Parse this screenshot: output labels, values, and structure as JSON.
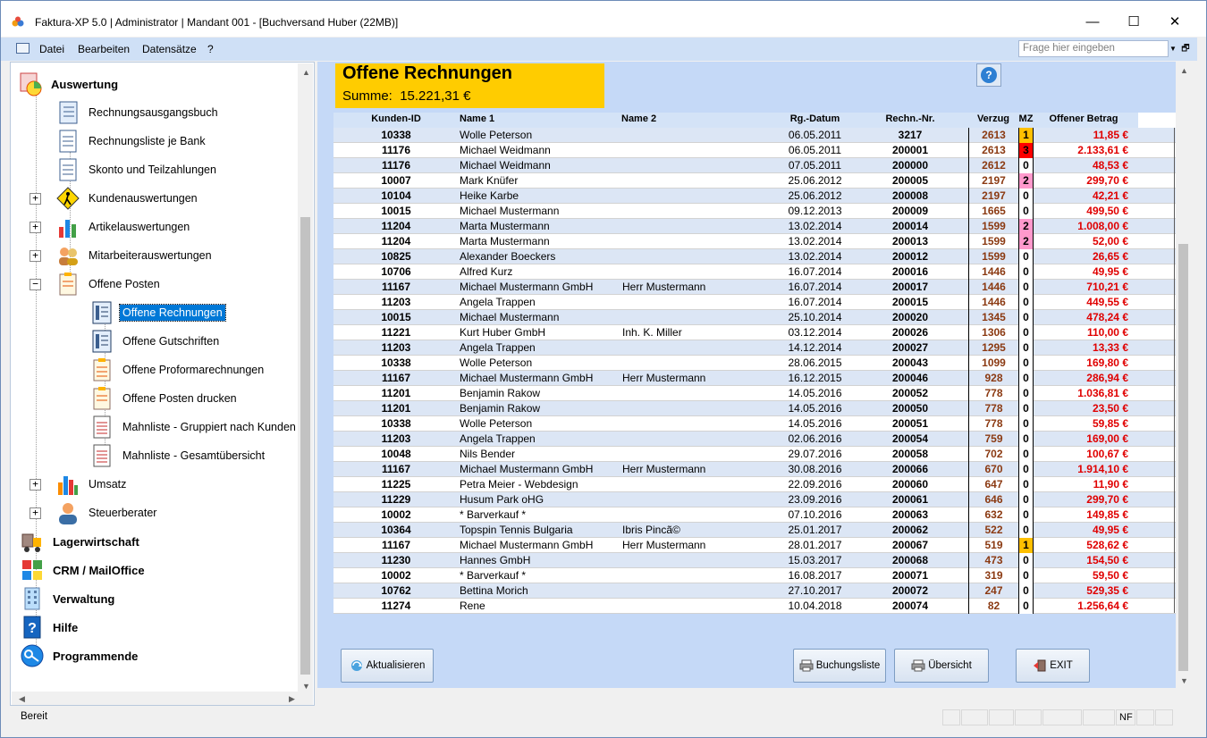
{
  "window": {
    "title": "Faktura-XP 5.0 | Administrator | Mandant 001 - [Buchversand Huber (22MB)]",
    "minimize_glyph": "—",
    "maximize_glyph": "☐",
    "close_glyph": "✕"
  },
  "menu": {
    "items": [
      "Datei",
      "Bearbeiten",
      "Datensätze",
      "?"
    ],
    "help_placeholder": "Frage hier eingeben",
    "drop_glyph": "▼",
    "restore_glyph": "🗗"
  },
  "tree": {
    "auswertung": "Auswertung",
    "items": [
      "Rechnungsausgangsbuch",
      "Rechnungsliste je Bank",
      "Skonto und Teilzahlungen",
      "Kundenauswertungen",
      "Artikelauswertungen",
      "Mitarbeiterauswertungen",
      "Offene Posten",
      "Offene Rechnungen",
      "Offene Gutschriften",
      "Offene Proformarechnungen",
      "Offene Posten drucken",
      "Mahnliste - Gruppiert nach Kunden",
      "Mahnliste - Gesamtübersicht",
      "Umsatz",
      "Steuerberater"
    ],
    "modules": [
      "Lagerwirtschaft",
      "CRM / MailOffice",
      "Verwaltung",
      "Hilfe",
      "Programmende"
    ],
    "expand_glyph": "+",
    "collapse_glyph": "−"
  },
  "header": {
    "title": "Offene Rechnungen",
    "summe_label": "Summe:",
    "summe_value": "15.221,31 €",
    "help_glyph": "?"
  },
  "grid": {
    "columns": [
      "Kunden-ID",
      "Name 1",
      "Name 2",
      "Rg.-Datum",
      "Rechn.-Nr.",
      "Verzug",
      "MZ",
      "Offener Betrag"
    ],
    "rows": [
      {
        "id": "10338",
        "name1": "Wolle Peterson",
        "name2": "",
        "date": "06.05.2011",
        "nr": "3217",
        "verzug": "2613",
        "mz": "1",
        "betrag": "11,85 €"
      },
      {
        "id": "11176",
        "name1": "Michael Weidmann",
        "name2": "",
        "date": "06.05.2011",
        "nr": "200001",
        "verzug": "2613",
        "mz": "3",
        "betrag": "2.133,61 €"
      },
      {
        "id": "11176",
        "name1": "Michael Weidmann",
        "name2": "",
        "date": "07.05.2011",
        "nr": "200000",
        "verzug": "2612",
        "mz": "0",
        "betrag": "48,53 €"
      },
      {
        "id": "10007",
        "name1": "Mark Knüfer",
        "name2": "",
        "date": "25.06.2012",
        "nr": "200005",
        "verzug": "2197",
        "mz": "2",
        "betrag": "299,70 €"
      },
      {
        "id": "10104",
        "name1": "Heike Karbe",
        "name2": "",
        "date": "25.06.2012",
        "nr": "200008",
        "verzug": "2197",
        "mz": "0",
        "betrag": "42,21 €"
      },
      {
        "id": "10015",
        "name1": "Michael Mustermann",
        "name2": "",
        "date": "09.12.2013",
        "nr": "200009",
        "verzug": "1665",
        "mz": "0",
        "betrag": "499,50 €"
      },
      {
        "id": "11204",
        "name1": "Marta Mustermann",
        "name2": "",
        "date": "13.02.2014",
        "nr": "200014",
        "verzug": "1599",
        "mz": "2",
        "betrag": "1.008,00 €"
      },
      {
        "id": "11204",
        "name1": "Marta Mustermann",
        "name2": "",
        "date": "13.02.2014",
        "nr": "200013",
        "verzug": "1599",
        "mz": "2",
        "betrag": "52,00 €"
      },
      {
        "id": "10825",
        "name1": "Alexander Boeckers",
        "name2": "",
        "date": "13.02.2014",
        "nr": "200012",
        "verzug": "1599",
        "mz": "0",
        "betrag": "26,65 €"
      },
      {
        "id": "10706",
        "name1": "Alfred Kurz",
        "name2": "",
        "date": "16.07.2014",
        "nr": "200016",
        "verzug": "1446",
        "mz": "0",
        "betrag": "49,95 €"
      },
      {
        "id": "11167",
        "name1": "Michael Mustermann GmbH",
        "name2": "Herr Mustermann",
        "date": "16.07.2014",
        "nr": "200017",
        "verzug": "1446",
        "mz": "0",
        "betrag": "710,21 €"
      },
      {
        "id": "11203",
        "name1": "Angela Trappen",
        "name2": "",
        "date": "16.07.2014",
        "nr": "200015",
        "verzug": "1446",
        "mz": "0",
        "betrag": "449,55 €"
      },
      {
        "id": "10015",
        "name1": "Michael Mustermann",
        "name2": "",
        "date": "25.10.2014",
        "nr": "200020",
        "verzug": "1345",
        "mz": "0",
        "betrag": "478,24 €"
      },
      {
        "id": "11221",
        "name1": "Kurt Huber GmbH",
        "name2": "Inh. K. Miller",
        "date": "03.12.2014",
        "nr": "200026",
        "verzug": "1306",
        "mz": "0",
        "betrag": "110,00 €"
      },
      {
        "id": "11203",
        "name1": "Angela Trappen",
        "name2": "",
        "date": "14.12.2014",
        "nr": "200027",
        "verzug": "1295",
        "mz": "0",
        "betrag": "13,33 €"
      },
      {
        "id": "10338",
        "name1": "Wolle Peterson",
        "name2": "",
        "date": "28.06.2015",
        "nr": "200043",
        "verzug": "1099",
        "mz": "0",
        "betrag": "169,80 €"
      },
      {
        "id": "11167",
        "name1": "Michael Mustermann GmbH",
        "name2": "Herr Mustermann",
        "date": "16.12.2015",
        "nr": "200046",
        "verzug": "928",
        "mz": "0",
        "betrag": "286,94 €"
      },
      {
        "id": "11201",
        "name1": "Benjamin Rakow",
        "name2": "",
        "date": "14.05.2016",
        "nr": "200052",
        "verzug": "778",
        "mz": "0",
        "betrag": "1.036,81 €"
      },
      {
        "id": "11201",
        "name1": "Benjamin Rakow",
        "name2": "",
        "date": "14.05.2016",
        "nr": "200050",
        "verzug": "778",
        "mz": "0",
        "betrag": "23,50 €"
      },
      {
        "id": "10338",
        "name1": "Wolle Peterson",
        "name2": "",
        "date": "14.05.2016",
        "nr": "200051",
        "verzug": "778",
        "mz": "0",
        "betrag": "59,85 €"
      },
      {
        "id": "11203",
        "name1": "Angela Trappen",
        "name2": "",
        "date": "02.06.2016",
        "nr": "200054",
        "verzug": "759",
        "mz": "0",
        "betrag": "169,00 €"
      },
      {
        "id": "10048",
        "name1": "Nils Bender",
        "name2": "",
        "date": "29.07.2016",
        "nr": "200058",
        "verzug": "702",
        "mz": "0",
        "betrag": "100,67 €"
      },
      {
        "id": "11167",
        "name1": "Michael Mustermann GmbH",
        "name2": "Herr Mustermann",
        "date": "30.08.2016",
        "nr": "200066",
        "verzug": "670",
        "mz": "0",
        "betrag": "1.914,10 €"
      },
      {
        "id": "11225",
        "name1": "Petra Meier - Webdesign",
        "name2": "",
        "date": "22.09.2016",
        "nr": "200060",
        "verzug": "647",
        "mz": "0",
        "betrag": "11,90 €"
      },
      {
        "id": "11229",
        "name1": "Husum Park oHG",
        "name2": "",
        "date": "23.09.2016",
        "nr": "200061",
        "verzug": "646",
        "mz": "0",
        "betrag": "299,70 €"
      },
      {
        "id": "10002",
        "name1": "* Barverkauf *",
        "name2": "",
        "date": "07.10.2016",
        "nr": "200063",
        "verzug": "632",
        "mz": "0",
        "betrag": "149,85 €"
      },
      {
        "id": "10364",
        "name1": "Topspin Tennis Bulgaria",
        "name2": "Ibris Pincã©",
        "date": "25.01.2017",
        "nr": "200062",
        "verzug": "522",
        "mz": "0",
        "betrag": "49,95 €"
      },
      {
        "id": "11167",
        "name1": "Michael Mustermann GmbH",
        "name2": "Herr Mustermann",
        "date": "28.01.2017",
        "nr": "200067",
        "verzug": "519",
        "mz": "1",
        "betrag": "528,62 €"
      },
      {
        "id": "11230",
        "name1": "Hannes GmbH",
        "name2": "",
        "date": "15.03.2017",
        "nr": "200068",
        "verzug": "473",
        "mz": "0",
        "betrag": "154,50 €"
      },
      {
        "id": "10002",
        "name1": "* Barverkauf *",
        "name2": "",
        "date": "16.08.2017",
        "nr": "200071",
        "verzug": "319",
        "mz": "0",
        "betrag": "59,50 €"
      },
      {
        "id": "10762",
        "name1": "Bettina Morich",
        "name2": "",
        "date": "27.10.2017",
        "nr": "200072",
        "verzug": "247",
        "mz": "0",
        "betrag": "529,35 €"
      },
      {
        "id": "11274",
        "name1": "Rene",
        "name2": "",
        "date": "10.04.2018",
        "nr": "200074",
        "verzug": "82",
        "mz": "0",
        "betrag": "1.256,64 €"
      }
    ],
    "mz_colors": {
      "0": "#ffffff",
      "1": "#ffc000",
      "2": "#ff99cc",
      "3": "#ff0000"
    },
    "row_colors": [
      "#dce6f5",
      "#ffffff"
    ]
  },
  "buttons": {
    "aktualisieren": "Aktualisieren",
    "buchungsliste": "Buchungsliste",
    "uebersicht": "Übersicht",
    "exit": "EXIT"
  },
  "status": {
    "text": "Bereit",
    "nf": "NF"
  },
  "colors": {
    "accent": "#0078d7",
    "title_bg": "#ffcc00",
    "content_bg": "#c5d9f7",
    "amount_red": "#e00000",
    "verzug_brown": "#8b3a12"
  }
}
